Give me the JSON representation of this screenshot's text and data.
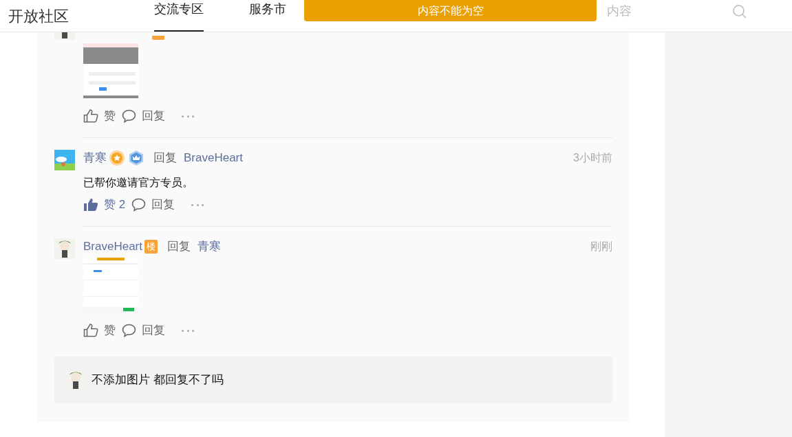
{
  "header": {
    "site_title": "开放社区",
    "nav": [
      {
        "label": "交流专区",
        "selected": true
      },
      {
        "label": "服务市",
        "selected": false
      }
    ],
    "search": {
      "placeholder": "内容"
    }
  },
  "toast": {
    "message": "内容不能为空"
  },
  "comments": [
    {
      "badges": [
        {
          "kind": "floor"
        }
      ],
      "image": true,
      "actions": {
        "like": {
          "label": "赞",
          "liked": false
        },
        "reply": "回复"
      }
    },
    {
      "author": "青寒",
      "badges": [
        {
          "kind": "star-medal"
        },
        {
          "kind": "crown-medal"
        }
      ],
      "reply_label": "回复",
      "reply_to": "BraveHeart",
      "time": "3小时前",
      "text": "已帮你邀请官方专员。",
      "actions": {
        "like": {
          "label": "赞 2",
          "liked": true
        },
        "reply": "回复"
      }
    },
    {
      "author": "BraveHeart",
      "badges": [
        {
          "kind": "floor",
          "text": "楼"
        }
      ],
      "reply_label": "回复",
      "reply_to": "青寒",
      "time": "刚刚",
      "image": true,
      "actions": {
        "like": {
          "label": "赞",
          "liked": false
        },
        "reply": "回复"
      }
    }
  ],
  "reply_box": {
    "value": "不添加图片 都回复不了吗"
  }
}
